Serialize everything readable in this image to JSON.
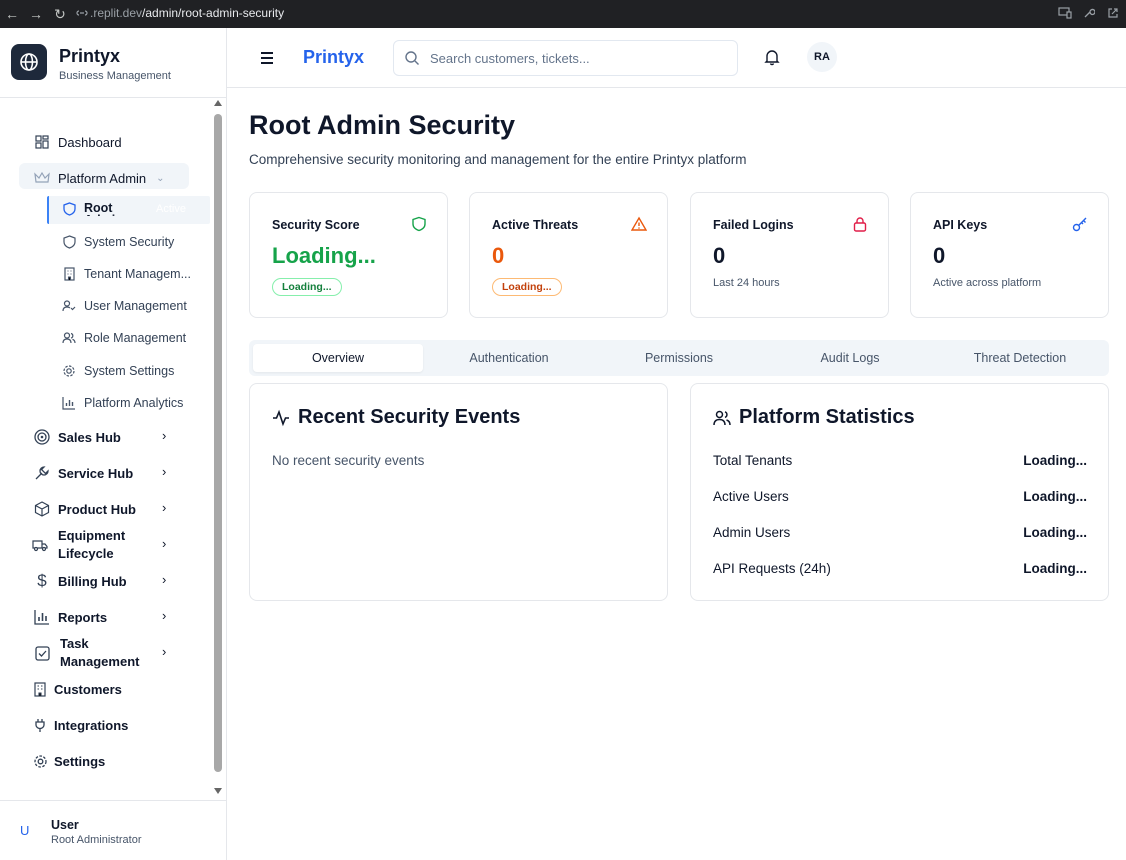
{
  "browser": {
    "url_host": ".replit.dev",
    "url_path": "/admin/root-admin-security"
  },
  "brand": {
    "name": "Printyx",
    "subtitle": "Business Management"
  },
  "sidebar": {
    "dashboard": "Dashboard",
    "platform_admin": "Platform Admin",
    "platform_admin_items": [
      {
        "label": "Root Admin",
        "badge": "Active"
      },
      {
        "label": "System Security"
      },
      {
        "label": "Tenant Managem..."
      },
      {
        "label": "User Management"
      },
      {
        "label": "Role Management"
      },
      {
        "label": "System Settings"
      },
      {
        "label": "Platform Analytics"
      }
    ],
    "hubs": [
      {
        "label": "Sales Hub"
      },
      {
        "label": "Service Hub"
      },
      {
        "label": "Product Hub"
      },
      {
        "label": "Equipment Lifecycle"
      },
      {
        "label": "Billing Hub"
      },
      {
        "label": "Reports"
      },
      {
        "label": "Task Management"
      }
    ],
    "bottom_items": [
      {
        "label": "Customers"
      },
      {
        "label": "Integrations"
      },
      {
        "label": "Settings"
      }
    ],
    "user": {
      "initial": "U",
      "name": "User",
      "role": "Root Administrator"
    }
  },
  "header": {
    "brand": "Printyx",
    "search_placeholder": "Search customers, tickets...",
    "avatar_initials": "RA"
  },
  "page": {
    "title": "Root Admin Security",
    "subtitle": "Comprehensive security monitoring and management for the entire Printyx platform"
  },
  "cards": [
    {
      "title": "Security Score",
      "value": "Loading...",
      "badge": "Loading...",
      "icon": "shield-icon",
      "color": "#16a34a"
    },
    {
      "title": "Active Threats",
      "value": "0",
      "badge": "Loading...",
      "icon": "alert-triangle-icon",
      "color": "#ea580c"
    },
    {
      "title": "Failed Logins",
      "value": "0",
      "note": "Last 24 hours",
      "icon": "lock-icon",
      "color": "#e11d48"
    },
    {
      "title": "API Keys",
      "value": "0",
      "note": "Active across platform",
      "icon": "key-icon",
      "color": "#2563eb"
    }
  ],
  "tabs": [
    {
      "label": "Overview",
      "active": true
    },
    {
      "label": "Authentication"
    },
    {
      "label": "Permissions"
    },
    {
      "label": "Audit Logs"
    },
    {
      "label": "Threat Detection"
    }
  ],
  "events_panel": {
    "title": "Recent Security Events",
    "empty": "No recent security events"
  },
  "stats_panel": {
    "title": "Platform Statistics",
    "rows": [
      {
        "label": "Total Tenants",
        "value": "Loading..."
      },
      {
        "label": "Active Users",
        "value": "Loading..."
      },
      {
        "label": "Admin Users",
        "value": "Loading..."
      },
      {
        "label": "API Requests (24h)",
        "value": "Loading..."
      }
    ]
  }
}
